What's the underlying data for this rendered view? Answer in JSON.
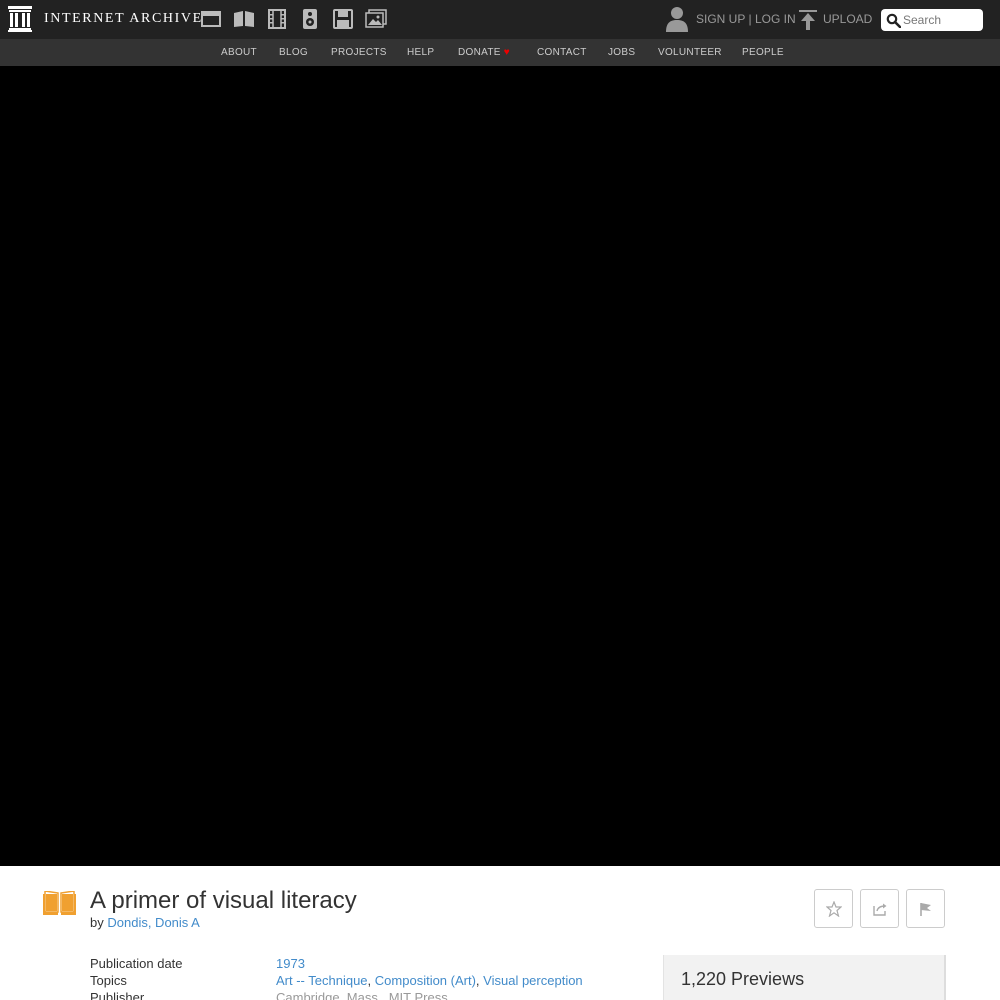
{
  "header": {
    "logo_text": "INTERNET ARCHIVE",
    "media_icons": [
      "web-icon",
      "texts-icon",
      "video-icon",
      "audio-icon",
      "software-icon",
      "images-icon"
    ],
    "sign_up": "SIGN UP",
    "separator": "|",
    "log_in": "LOG IN",
    "upload": "UPLOAD",
    "search_placeholder": "Search"
  },
  "subnav": {
    "items": [
      "ABOUT",
      "BLOG",
      "PROJECTS",
      "HELP",
      "DONATE",
      "CONTACT",
      "JOBS",
      "VOLUNTEER",
      "PEOPLE"
    ],
    "donate_heart": "♥"
  },
  "item": {
    "title": "A primer of visual literacy",
    "by_label": "by",
    "author": "Dondis, Donis A",
    "actions": [
      "favorite-button",
      "share-button",
      "flag-button"
    ]
  },
  "metadata": {
    "pub_date_label": "Publication date",
    "pub_date": "1973",
    "topics_label": "Topics",
    "topics": [
      "Art -- Technique",
      "Composition (Art)",
      "Visual perception"
    ],
    "topic_sep": ",",
    "publisher_label": "Publisher",
    "publisher": "Cambridge, Mass., MIT Press"
  },
  "previews": {
    "label": "1,220 Previews"
  },
  "colors": {
    "topbar": "#222222",
    "subnav": "#333333",
    "viewer": "#000000",
    "link": "#428bca",
    "book_icon": "#f0a030"
  }
}
